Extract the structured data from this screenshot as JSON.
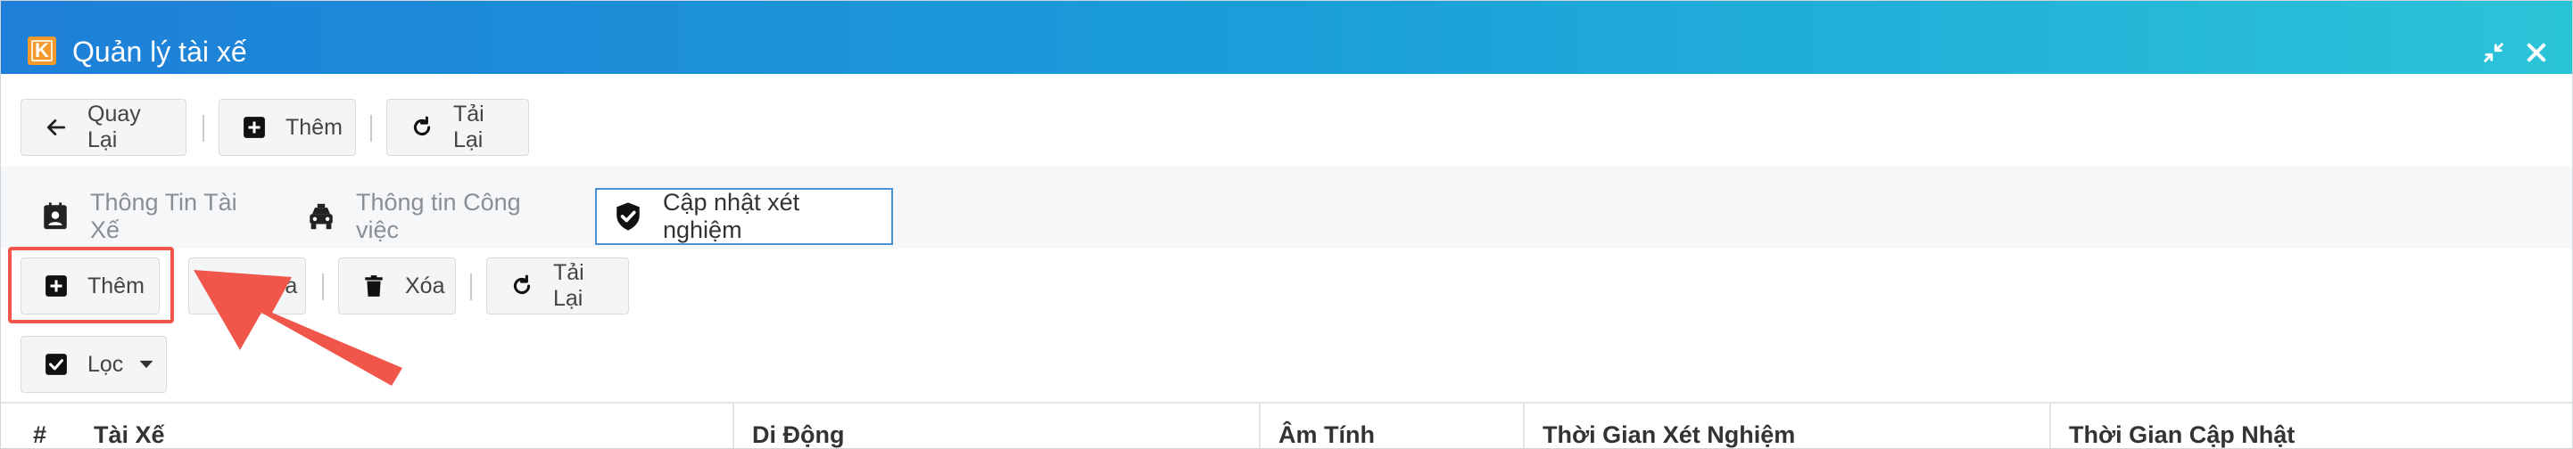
{
  "window": {
    "title": "Quản lý tài xế",
    "logo_letter": "K",
    "accent_gradient": [
      "#1e7fd8",
      "#2ac4d8"
    ]
  },
  "main_toolbar": {
    "back_label": "Quay Lại",
    "add_label": "Thêm",
    "reload_label": "Tải Lại"
  },
  "tabs": [
    {
      "label": "Thông Tin Tài Xế",
      "icon": "id-card-icon",
      "active": false
    },
    {
      "label": "Thông tin Công việc",
      "icon": "taxi-icon",
      "active": false
    },
    {
      "label": "Cập nhật xét nghiệm",
      "icon": "shield-check-icon",
      "active": true
    }
  ],
  "sub_toolbar": {
    "add_label": "Thêm",
    "edit_label": "Sửa",
    "delete_label": "Xóa",
    "reload_label": "Tải Lại",
    "filter_label": "Lọc"
  },
  "table": {
    "columns": [
      "#",
      "Tài Xế",
      "Di Động",
      "Âm Tính",
      "Thời Gian Xét Nghiệm",
      "Thời Gian Cập Nhật"
    ]
  },
  "annotation": {
    "highlight_color": "#f0564a"
  }
}
